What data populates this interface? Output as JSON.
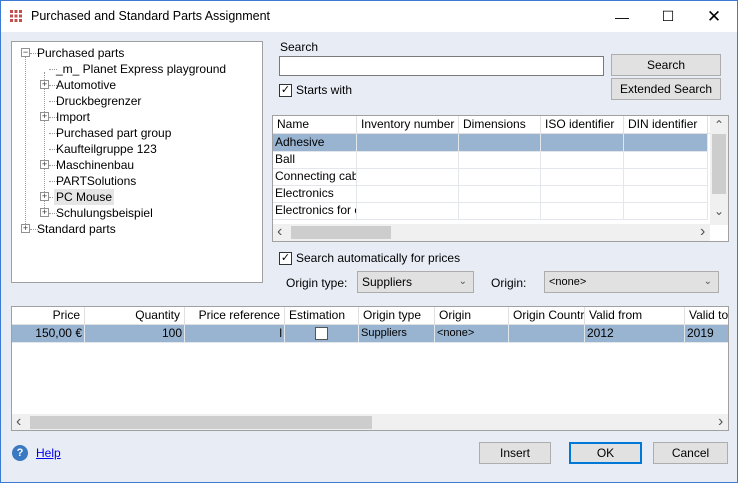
{
  "window": {
    "title": "Purchased and Standard Parts Assignment",
    "icon": "grid-app-icon",
    "controls": [
      "minimize",
      "maximize",
      "close"
    ]
  },
  "tree": {
    "items": [
      {
        "label": "Purchased parts",
        "level": 0,
        "expander": "minus"
      },
      {
        "label": "_m_ Planet Express playground",
        "level": 1,
        "expander": "none"
      },
      {
        "label": "Automotive",
        "level": 1,
        "expander": "plus"
      },
      {
        "label": "Druckbegrenzer",
        "level": 1,
        "expander": "none"
      },
      {
        "label": "Import",
        "level": 1,
        "expander": "plus"
      },
      {
        "label": "Purchased part group",
        "level": 1,
        "expander": "none"
      },
      {
        "label": "Kaufteilgruppe 123",
        "level": 1,
        "expander": "none"
      },
      {
        "label": "Maschinenbau",
        "level": 1,
        "expander": "plus"
      },
      {
        "label": "PARTSolutions",
        "level": 1,
        "expander": "none"
      },
      {
        "label": "PC Mouse",
        "level": 1,
        "expander": "plus",
        "highlighted": true
      },
      {
        "label": "Schulungsbeispiel",
        "level": 1,
        "expander": "plus"
      },
      {
        "label": "Standard parts",
        "level": 0,
        "expander": "plus"
      }
    ]
  },
  "search": {
    "group_label": "Search",
    "value": "",
    "search_button": "Search",
    "extended_button": "Extended Search",
    "starts_with_label": "Starts with",
    "starts_with_checked": true
  },
  "results": {
    "columns": [
      "Name",
      "Inventory number",
      "Dimensions",
      "ISO identifier",
      "DIN identifier"
    ],
    "rows": [
      "Adhesive",
      "Ball",
      "Connecting cabl",
      "Electronics",
      "Electronics for c"
    ],
    "selected_row": 0
  },
  "prices": {
    "auto_label": "Search automatically for prices",
    "auto_checked": true,
    "origin_type_label": "Origin type:",
    "origin_type_value": "Suppliers",
    "origin_label": "Origin:",
    "origin_value": "<none>"
  },
  "price_table": {
    "columns": [
      "Price",
      "Quantity",
      "Price reference",
      "Estimation",
      "Origin type",
      "Origin",
      "Origin Countr",
      "Valid from",
      "Valid to"
    ],
    "rows": [
      {
        "price": "150,00 €",
        "quantity": "100",
        "price_reference": "l",
        "estimation": false,
        "origin_type": "Suppliers",
        "origin": "<none>",
        "origin_country": "",
        "valid_from": "2012",
        "valid_to": "2019"
      }
    ]
  },
  "footer": {
    "help_label": "Help",
    "insert_button": "Insert",
    "ok_button": "OK",
    "cancel_button": "Cancel"
  },
  "colors": {
    "selection": "#99b4d1",
    "background": "#e8edf5",
    "accent_border": "#0078d7"
  }
}
